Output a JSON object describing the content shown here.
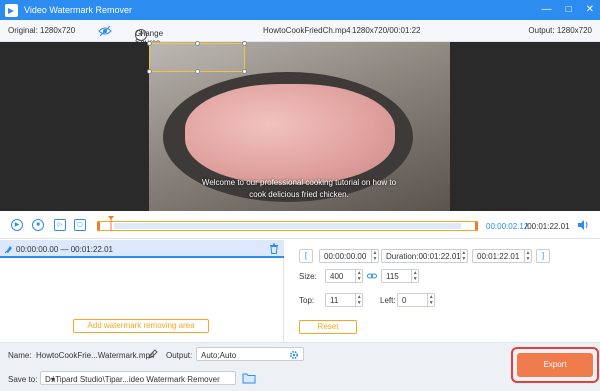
{
  "window": {
    "title": "Video Watermark Remover",
    "controls": [
      "—",
      "□",
      "✕"
    ]
  },
  "info": {
    "original": "Original: 1280x720",
    "change_source": "Change Source File",
    "file_name": "HowtoCookFriedCh.mp4",
    "resolution_duration": "1280x720/00:01:22",
    "output": "Output: 1280x720"
  },
  "video": {
    "subtitle_line1": "Welcome to our professional cooking tutorial on how to",
    "subtitle_line2": "cook delicious fried chicken."
  },
  "playback": {
    "current_time": "00:00:02.12",
    "total_time": "/00:01:22.01",
    "progress": 0.026
  },
  "segment": {
    "range": "00:00:00.00 — 00:01:22.01",
    "add_area_label": "Add watermark removing area"
  },
  "params": {
    "start": "00:00:00.00",
    "duration_label": "Duration:00:01:22.01",
    "end": "00:01:22.01",
    "size_label": "Size:",
    "width": "400",
    "height": "115",
    "top_label": "Top:",
    "top": "11",
    "left_label": "Left:",
    "left": "0",
    "reset_label": "Reset"
  },
  "bottom": {
    "name_label": "Name:",
    "name_value": "HowtoCookFrie...Watermark.mp4",
    "output_label": "Output:",
    "output_value": "Auto;Auto",
    "save_label": "Save to:",
    "save_value": "D:\\Tipard Studio\\Tipar...ideo Watermark Remover",
    "export_label": "Export"
  },
  "colors": {
    "accent": "#2d8cf0",
    "orange": "#f5a623",
    "export": "#f07b4c",
    "highlight_ring": "#e43f3f"
  }
}
